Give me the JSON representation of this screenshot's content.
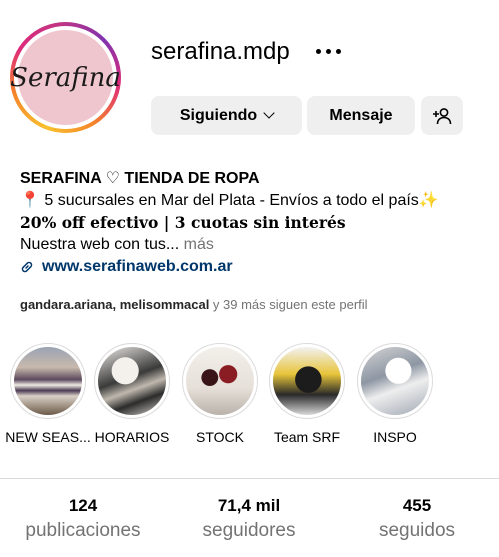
{
  "profile": {
    "avatar_text": "Serafina",
    "username": "serafina.mdp",
    "buttons": {
      "following": "Siguiendo",
      "message": "Mensaje"
    },
    "bio": {
      "name": "SERAFINA ♡ TIENDA DE ROPA",
      "line1": "📍 5 sucursales en Mar del Plata - Envíos a todo el país✨",
      "line2": "20% off efectivo | 3 cuotas sin interés",
      "line3": "Nuestra web con tus...",
      "more": "más",
      "link": "www.serafinaweb.com.ar"
    },
    "followed_by": {
      "users": "gandara.ariana, melisommacal",
      "rest": " y 39 más siguen este perfil"
    }
  },
  "highlights": [
    {
      "label": "NEW SEAS..."
    },
    {
      "label": "HORARIOS"
    },
    {
      "label": "STOCK"
    },
    {
      "label": "Team SRF"
    },
    {
      "label": "INSPO"
    }
  ],
  "stats": [
    {
      "value": "124",
      "label": "publicaciones"
    },
    {
      "value": "71,4 mil",
      "label": "seguidores"
    },
    {
      "value": "455",
      "label": "seguidos"
    }
  ],
  "colors": {
    "accent_link": "#00376b",
    "button_bg": "#efefef",
    "muted": "#737373"
  }
}
